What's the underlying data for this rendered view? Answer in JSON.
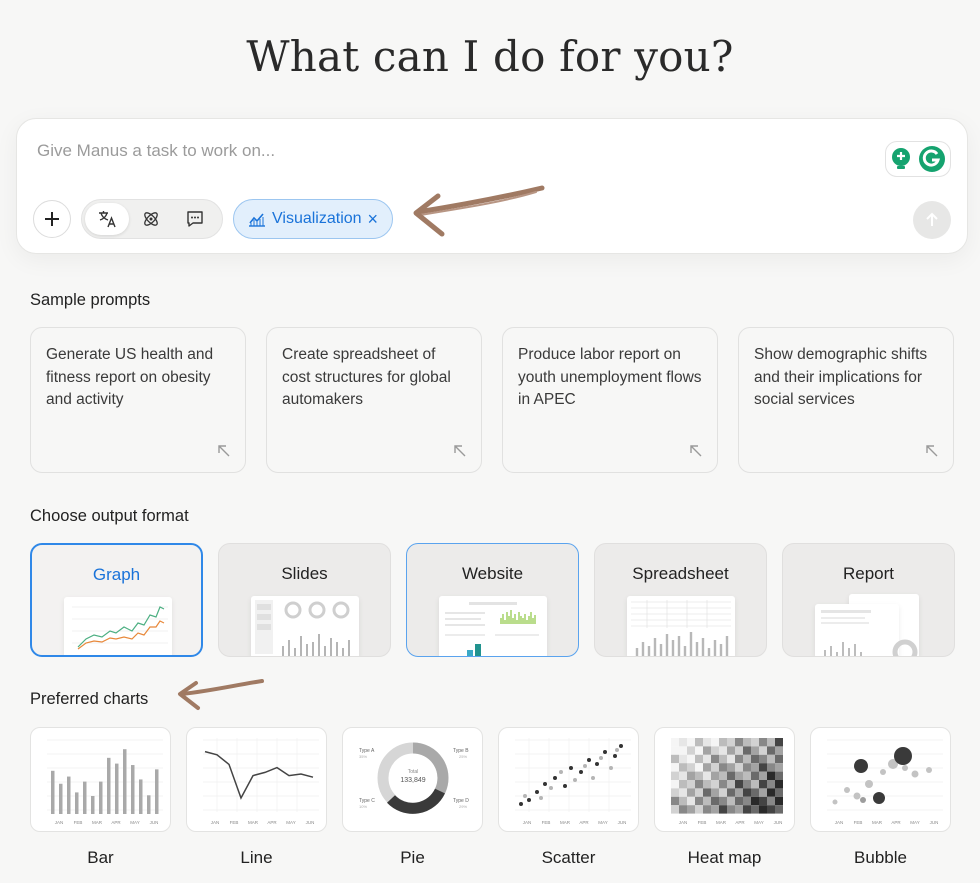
{
  "hero": {
    "title": "What can I do for you?"
  },
  "composer": {
    "placeholder": "Give Manus a task to work on...",
    "chip_label": "Visualization",
    "chip_close": "×"
  },
  "sample_prompts": {
    "title": "Sample prompts",
    "items": [
      "Generate US health and fitness report on obesity and activity",
      "Create spreadsheet of cost structures for global automakers",
      "Produce labor report on youth unemployment flows in APEC",
      "Show demographic shifts and their implications for social services"
    ]
  },
  "output_format": {
    "title": "Choose output format",
    "selected": "Graph",
    "items": [
      "Graph",
      "Slides",
      "Website",
      "Spreadsheet",
      "Report"
    ]
  },
  "preferred_charts": {
    "title": "Preferred charts",
    "items": [
      "Bar",
      "Line",
      "Pie",
      "Scatter",
      "Heat map",
      "Bubble"
    ],
    "pie": {
      "total_label": "Total",
      "total_value": "133,849",
      "segments": [
        "Type A",
        "Type B",
        "Type C",
        "Type D"
      ],
      "segment_pcts": [
        "35%",
        "25%",
        "10%",
        "29%"
      ]
    },
    "months": [
      "JAN",
      "FEB",
      "MAR",
      "APR",
      "MAY",
      "JUN"
    ],
    "bar_values": [
      60,
      42,
      52,
      30,
      45,
      25,
      45,
      78,
      70,
      90,
      68,
      48,
      26,
      62
    ],
    "line_values": [
      78,
      74,
      62,
      20,
      48,
      52,
      58,
      48,
      50,
      46
    ]
  },
  "colors": {
    "accent": "#1a73d9",
    "chip_bg": "#e2effc",
    "annotation_arrow": "#a07a63",
    "grammarly_green": "#15a36f"
  },
  "icons": {
    "add": "plus-icon",
    "mode1": "translate-icon",
    "mode2": "atom-icon",
    "mode3": "chat-icon",
    "chip": "chart-line-icon",
    "send": "arrow-up-icon",
    "prompt_arrow": "arrow-up-left-icon"
  }
}
